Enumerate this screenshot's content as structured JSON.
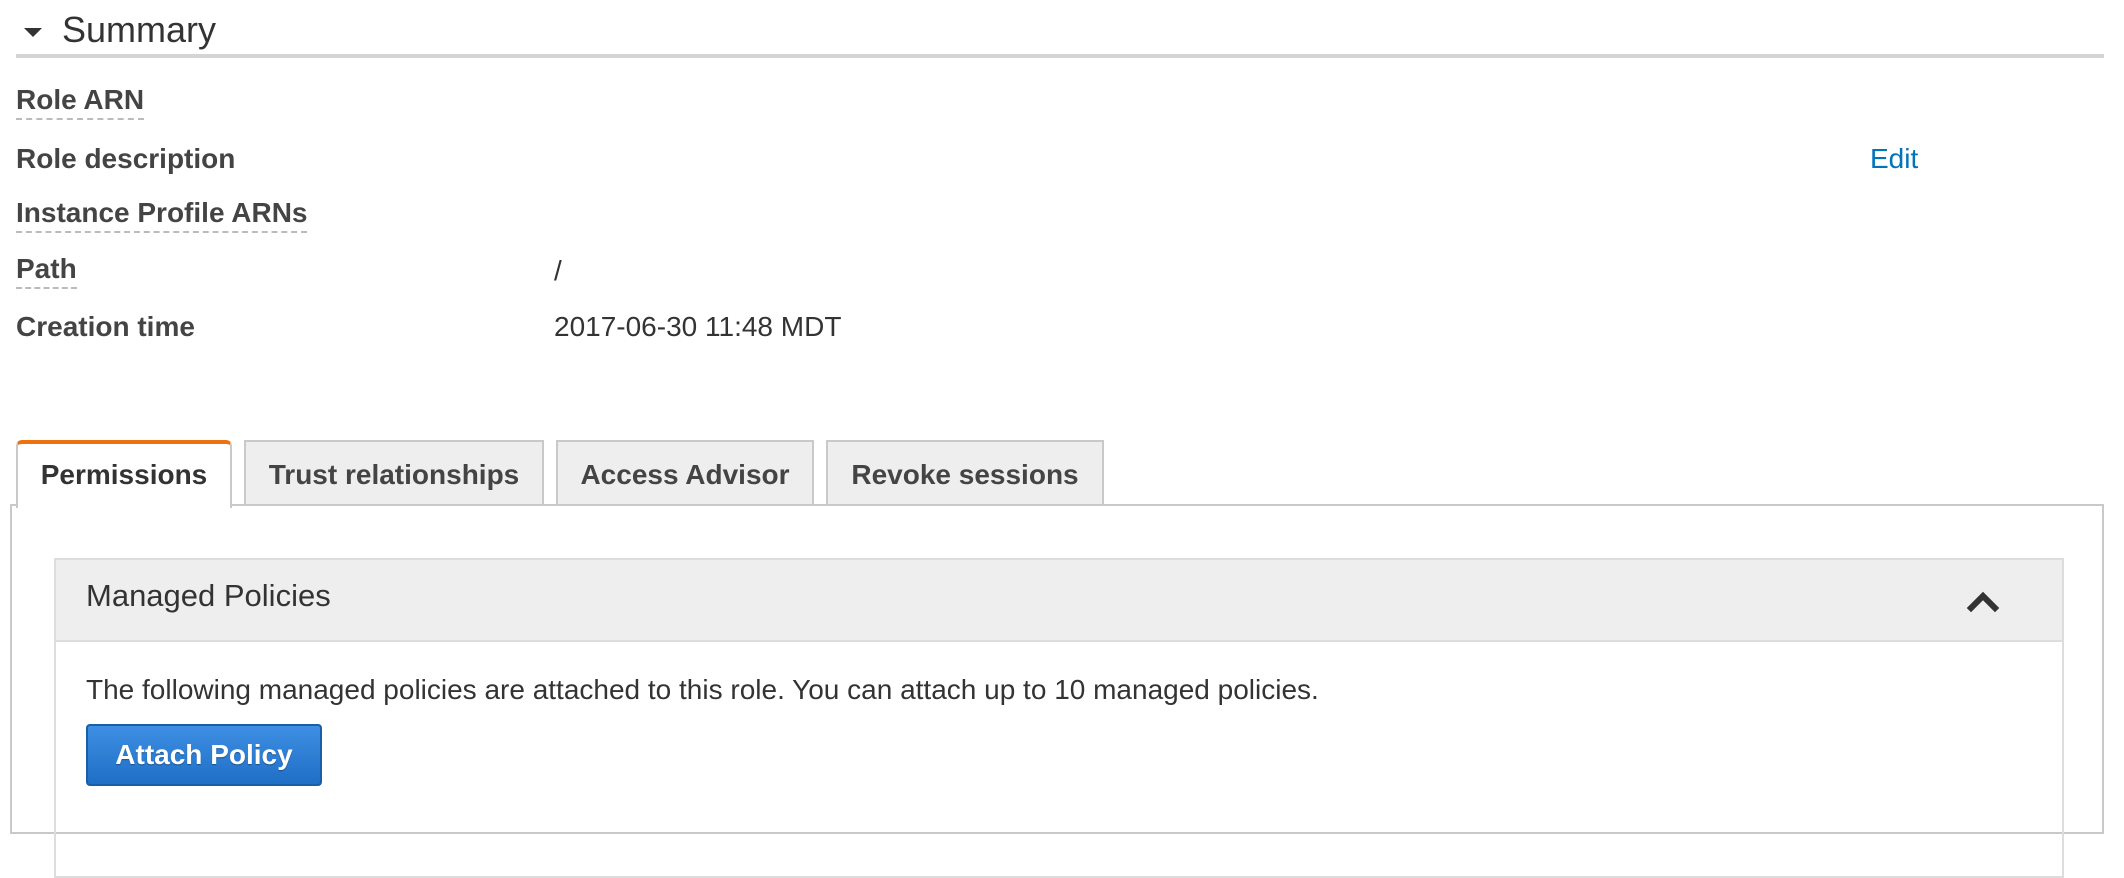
{
  "summary": {
    "title": "Summary",
    "rows": [
      {
        "label": "Role ARN",
        "value": ""
      },
      {
        "label": "Role description",
        "value": "",
        "action": "Edit"
      },
      {
        "label": "Instance Profile ARNs",
        "value": ""
      },
      {
        "label": "Path",
        "value": "/"
      },
      {
        "label": "Creation time",
        "value": "2017-06-30 11:48 MDT"
      }
    ]
  },
  "tabs": [
    {
      "label": "Permissions",
      "active": true
    },
    {
      "label": "Trust relationships",
      "active": false
    },
    {
      "label": "Access Advisor",
      "active": false
    },
    {
      "label": "Revoke sessions",
      "active": false
    }
  ],
  "managed_policies": {
    "title": "Managed Policies",
    "description": "The following managed policies are attached to this role. You can attach up to 10 managed policies.",
    "attach_button_label": "Attach Policy",
    "collapse_icon": "chevron-up-icon"
  },
  "colors": {
    "link": "#0073bb",
    "active_tab_accent": "#ec7211",
    "primary_button": "#1f6fc7"
  }
}
